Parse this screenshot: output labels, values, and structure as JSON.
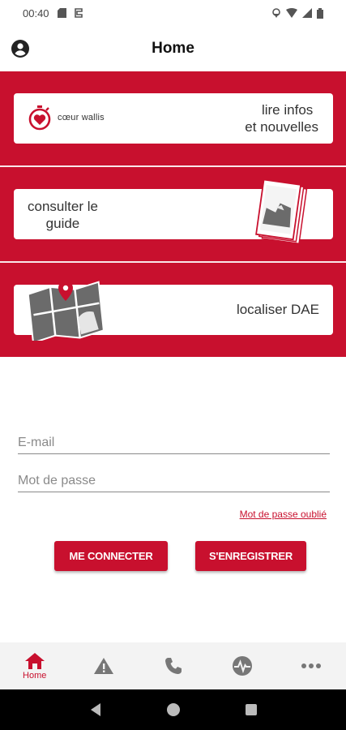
{
  "status_bar": {
    "time": "00:40"
  },
  "header": {
    "title": "Home"
  },
  "tiles": {
    "news": {
      "logo_text": "cœur wallis",
      "label_line1": "lire infos",
      "label_line2": "et nouvelles"
    },
    "guide": {
      "label_line1": "consulter le",
      "label_line2": "guide"
    },
    "dae": {
      "label": "localiser DAE"
    }
  },
  "login": {
    "email_placeholder": "E-mail",
    "password_placeholder": "Mot de passe",
    "forgot_link": "Mot de passe oublié",
    "connect_button": "ME CONNECTER",
    "register_button": "S'ENREGISTRER"
  },
  "bottom_nav": {
    "items": [
      {
        "label": "Home",
        "icon": "home-icon",
        "active": true
      },
      {
        "label": "",
        "icon": "warning-icon",
        "active": false
      },
      {
        "label": "",
        "icon": "phone-icon",
        "active": false
      },
      {
        "label": "",
        "icon": "heartbeat-icon",
        "active": false
      },
      {
        "label": "",
        "icon": "more-icon",
        "active": false
      }
    ]
  },
  "colors": {
    "brand_red": "#c8102e",
    "nav_bg": "#f3f3f3",
    "inactive_icon": "#777777"
  }
}
